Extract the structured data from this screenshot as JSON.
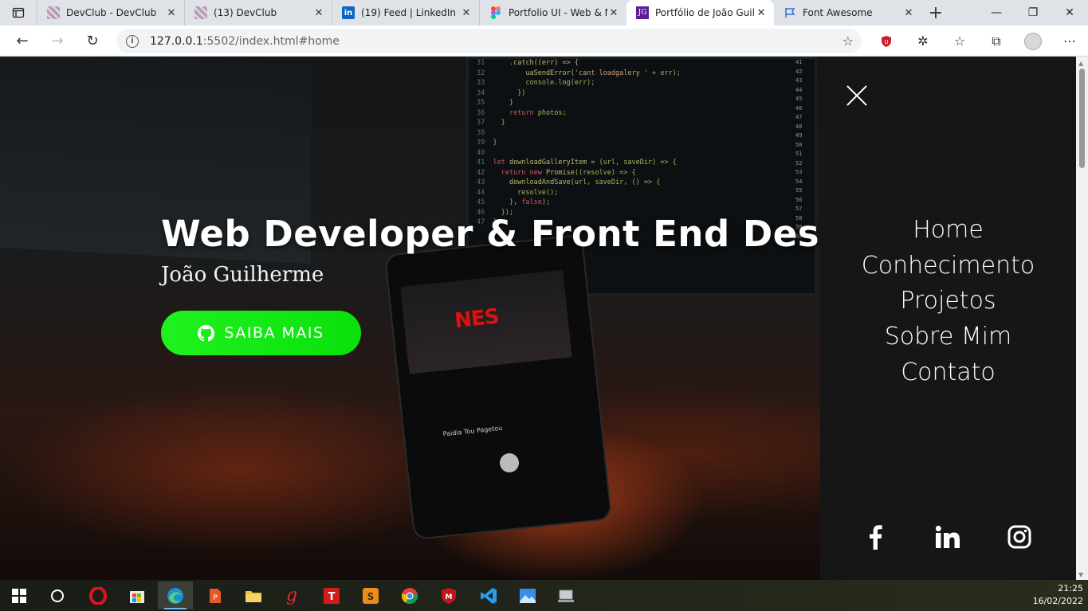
{
  "browser": {
    "tabs": [
      {
        "title": "DevClub - DevClub",
        "favicon": "devclub-icon",
        "active": false
      },
      {
        "title": "(13) DevClub",
        "favicon": "devclub-icon",
        "active": false
      },
      {
        "title": "(19) Feed | LinkedIn",
        "favicon": "linkedin-icon",
        "active": false
      },
      {
        "title": "Portfolio UI - Web & M",
        "favicon": "figma-icon",
        "active": false
      },
      {
        "title": "Portfólio de João Guilh",
        "favicon": "jg-icon",
        "active": true
      },
      {
        "title": "Font Awesome",
        "favicon": "flag-icon",
        "active": false
      }
    ],
    "jg_favicon_text": "JG",
    "url_host": "127.0.0.1",
    "url_rest": ":5502/index.html#home"
  },
  "hero": {
    "title": "Web Developer & Front End Design",
    "subtitle": "João Guilherme",
    "cta_label": "SAIBA MAIS",
    "cta_color": "#18f418"
  },
  "menu": {
    "items": [
      "Home",
      "Conhecimento",
      "Projetos",
      "Sobre Mim",
      "Contato"
    ],
    "social": [
      "facebook-icon",
      "linkedin-icon",
      "instagram-icon"
    ]
  },
  "taskbar": {
    "time": "21:25",
    "date": "16/02/2022"
  }
}
